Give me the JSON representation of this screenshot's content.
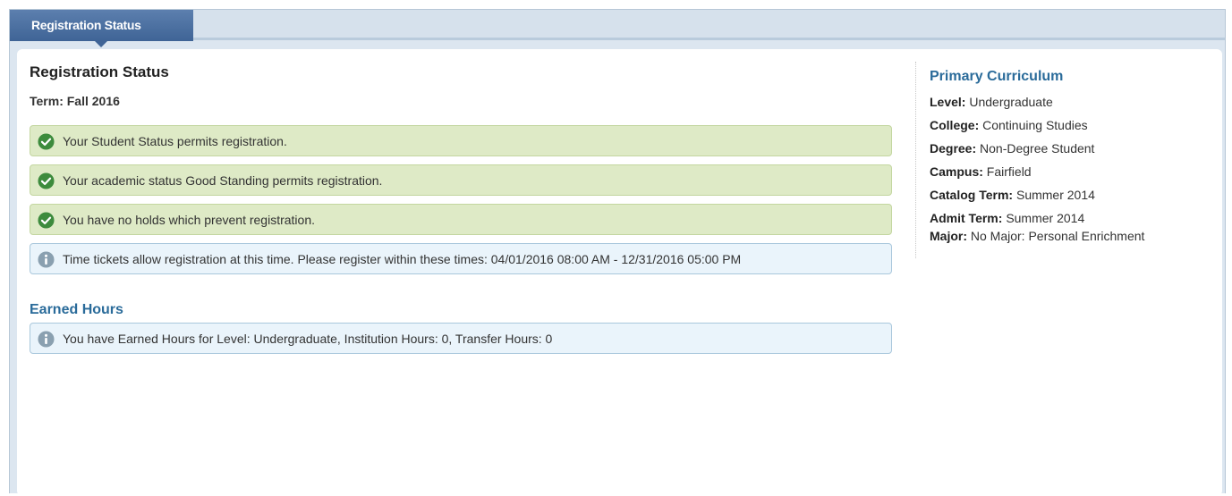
{
  "tab": {
    "label": "Registration Status"
  },
  "main": {
    "heading": "Registration Status",
    "term": "Term: Fall 2016",
    "messages": [
      {
        "type": "success",
        "text": "Your Student Status permits registration."
      },
      {
        "type": "success",
        "text": "Your academic status Good Standing permits registration."
      },
      {
        "type": "success",
        "text": "You have no holds which prevent registration."
      },
      {
        "type": "info",
        "text": "Time tickets allow registration at this time. Please register within these times: 04/01/2016 08:00 AM - 12/31/2016 05:00 PM"
      }
    ],
    "earned_heading": "Earned Hours",
    "earned_message": "You have Earned Hours for Level: Undergraduate, Institution Hours: 0, Transfer Hours: 0"
  },
  "curriculum": {
    "heading": "Primary Curriculum",
    "rows": [
      {
        "label": "Level:",
        "value": "Undergraduate"
      },
      {
        "label": "College:",
        "value": "Continuing Studies"
      },
      {
        "label": "Degree:",
        "value": "Non-Degree Student"
      },
      {
        "label": "Campus:",
        "value": "Fairfield"
      },
      {
        "label": "Catalog Term:",
        "value": "Summer 2014"
      },
      {
        "label": "Admit Term:",
        "value": "Summer 2014"
      },
      {
        "label": "Major:",
        "value": "No Major: Personal Enrichment"
      }
    ]
  },
  "icons": {
    "success": "check-circle-icon",
    "info": "info-circle-icon"
  },
  "colors": {
    "tab": "#4a6ea3",
    "success_bg": "#deeac6",
    "info_bg": "#eaf4fb",
    "heading_blue": "#2a6b9a",
    "check_green": "#3d8b3d",
    "info_gray": "#8aa0b0"
  }
}
